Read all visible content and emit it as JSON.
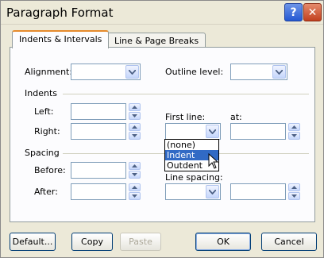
{
  "window": {
    "title": "Paragraph Format"
  },
  "tabs": [
    {
      "label": "Indents & Intervals",
      "active": true
    },
    {
      "label": "Line & Page Breaks",
      "active": false
    }
  ],
  "fields": {
    "alignment_label": "Alignment:",
    "alignment_value": "",
    "outline_label": "Outline level:",
    "outline_value": "",
    "indents_group": "Indents",
    "left_label": "Left:",
    "left_value": "",
    "right_label": "Right:",
    "right_value": "",
    "first_line_label": "First line:",
    "first_line_value": "",
    "at_label": "at:",
    "at_value": "",
    "spacing_group": "Spacing",
    "before_label": "Before:",
    "before_value": "",
    "after_label": "After:",
    "after_value": "",
    "line_spacing_label": "Line spacing:",
    "line_spacing_value": "",
    "line_spacing_at_value": ""
  },
  "first_line_dropdown": {
    "options": [
      "(none)",
      "Indent",
      "Outdent"
    ],
    "highlighted_index": 1
  },
  "buttons": {
    "default": "Default...",
    "copy": "Copy",
    "paste": "Paste",
    "ok": "OK",
    "cancel": "Cancel"
  },
  "colors": {
    "dialog_bg": "#ece9d8",
    "selection": "#316ac5",
    "active_tab_accent": "#e68b2c"
  }
}
